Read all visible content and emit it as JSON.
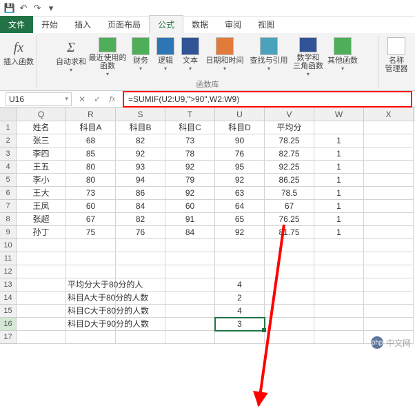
{
  "qat": {
    "save": "💾",
    "undo": "↶",
    "redo": "↷",
    "more": "▾"
  },
  "tabs": {
    "file": "文件",
    "items": [
      "开始",
      "插入",
      "页面布局",
      "公式",
      "数据",
      "审阅",
      "视图"
    ],
    "active_index": 3
  },
  "ribbon": {
    "insert_fn": "插入函数",
    "autosum": "自动求和",
    "recent": "最近使用的\n函数",
    "financial": "财务",
    "logical": "逻辑",
    "text": "文本",
    "datetime": "日期和时间",
    "lookup": "查找与引用",
    "mathtrig": "数学和\n三角函数",
    "more": "其他函数",
    "namemgr": "名称\n管理器",
    "group_label": "函数库"
  },
  "namebox": "U16",
  "formula": "=SUMIF(U2:U9,\">90\",W2:W9)",
  "columns": [
    "Q",
    "R",
    "S",
    "T",
    "U",
    "V",
    "W",
    "X"
  ],
  "grid": {
    "header": [
      "姓名",
      "科目A",
      "科目B",
      "科目C",
      "科目D",
      "平均分",
      "",
      ""
    ],
    "rows": [
      [
        "张三",
        "68",
        "82",
        "73",
        "90",
        "78.25",
        "1",
        ""
      ],
      [
        "李四",
        "85",
        "92",
        "78",
        "76",
        "82.75",
        "1",
        ""
      ],
      [
        "王五",
        "80",
        "93",
        "92",
        "95",
        "92.25",
        "1",
        ""
      ],
      [
        "李小",
        "80",
        "94",
        "79",
        "92",
        "86.25",
        "1",
        ""
      ],
      [
        "王大",
        "73",
        "86",
        "92",
        "63",
        "78.5",
        "1",
        ""
      ],
      [
        "王凤",
        "60",
        "84",
        "60",
        "64",
        "67",
        "1",
        ""
      ],
      [
        "张超",
        "67",
        "82",
        "91",
        "65",
        "76.25",
        "1",
        ""
      ],
      [
        "孙丁",
        "75",
        "76",
        "84",
        "92",
        "81.75",
        "1",
        ""
      ]
    ],
    "stats": [
      {
        "label": "平均分大于80分的人",
        "value": "4"
      },
      {
        "label": "科目A大于80分的人数",
        "value": "2"
      },
      {
        "label": "科目C大于80分的人数",
        "value": "4"
      },
      {
        "label": "科目D大于90分的人数",
        "value": "3"
      }
    ]
  },
  "watermark": {
    "logo": "php",
    "text": "中文网"
  }
}
